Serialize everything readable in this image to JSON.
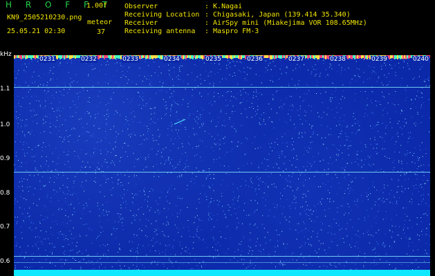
{
  "header": {
    "program": "H R O F F T",
    "version": "1.00f",
    "filename": "KN9_2505210230.png",
    "datetime": "25.05.21 02:30",
    "meteor_label": "meteor",
    "meteor_count": "37",
    "fields": [
      {
        "label": "Observer",
        "value": ": K.Nagai"
      },
      {
        "label": "Receiving Location",
        "value": ": Chigasaki, Japan (139.414 35.340)"
      },
      {
        "label": "Receiver",
        "value": ": AirSpy mini (Miakejima VOR 108.65MHz)"
      },
      {
        "label": "Receiving antenna",
        "value": ": Maspro FM-3"
      }
    ]
  },
  "axis": {
    "unit": "kHz",
    "y_ticks": [
      "1.1",
      "1.0",
      "0.9",
      "0.8",
      "0.7",
      "0.6"
    ],
    "time_ticks": [
      "0231",
      "0232",
      "0233",
      "0234",
      "0235",
      "0236",
      "0237",
      "0238",
      "0239",
      "0240"
    ]
  },
  "colors": {
    "background": "#0a28a8",
    "carrier_lines": "#7fe6ff",
    "meteor_trail": "#4fe0ff",
    "bottom_band": "#10e8ff",
    "logo": "#22d24a",
    "info_text": "#f2e600"
  },
  "chart_data": {
    "type": "heatmap",
    "xlabel": "",
    "ylabel": "kHz",
    "y_range": [
      0.57,
      1.15
    ],
    "x_categories": [
      "0231",
      "0232",
      "0233",
      "0234",
      "0235",
      "0236",
      "0237",
      "0238",
      "0239",
      "0240"
    ],
    "carrier_lines_khz": [
      1.105,
      0.863,
      0.615
    ],
    "meteor_echo": {
      "time": "0234",
      "khz_start": 1.0,
      "khz_end": 1.01
    }
  }
}
